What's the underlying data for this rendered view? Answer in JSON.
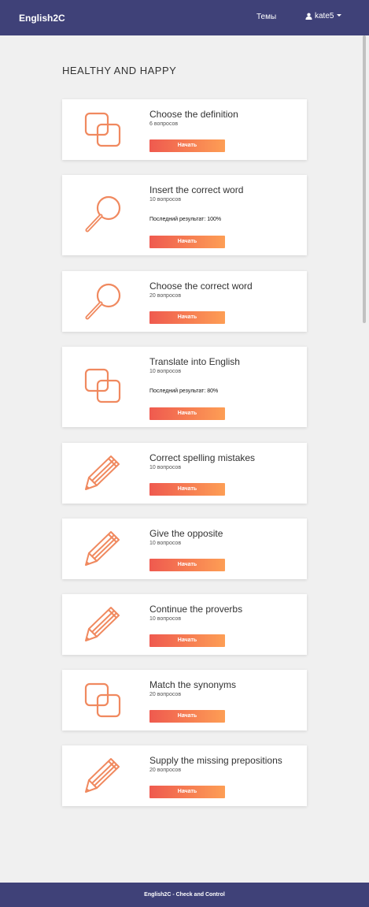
{
  "navbar": {
    "brand": "English2C",
    "topics_label": "Темы",
    "user_name": "kate5",
    "user_icon": "user-icon"
  },
  "page": {
    "title": "HEALTHY AND HAPPY"
  },
  "cards": [
    {
      "title": "Choose the definition",
      "count": "6 вопросов",
      "result": "",
      "button": "Начать",
      "icon": "squares-icon"
    },
    {
      "title": "Insert the correct word",
      "count": "10 вопросов",
      "result": "Последний результат: 100%",
      "button": "Начать",
      "icon": "magnifier-icon"
    },
    {
      "title": "Choose the correct word",
      "count": "20 вопросов",
      "result": "",
      "button": "Начать",
      "icon": "magnifier-icon"
    },
    {
      "title": "Translate into English",
      "count": "10 вопросов",
      "result": "Последний результат: 80%",
      "button": "Начать",
      "icon": "squares-icon"
    },
    {
      "title": "Correct spelling mistakes",
      "count": "10 вопросов",
      "result": "",
      "button": "Начать",
      "icon": "pencil-icon"
    },
    {
      "title": "Give the opposite",
      "count": "10 вопросов",
      "result": "",
      "button": "Начать",
      "icon": "pencil-icon"
    },
    {
      "title": "Continue the proverbs",
      "count": "10 вопросов",
      "result": "",
      "button": "Начать",
      "icon": "pencil-icon"
    },
    {
      "title": "Match the synonyms",
      "count": "20 вопросов",
      "result": "",
      "button": "Начать",
      "icon": "squares-icon"
    },
    {
      "title": "Supply the missing prepositions",
      "count": "20 вопросов",
      "result": "",
      "button": "Начать",
      "icon": "pencil-icon"
    }
  ],
  "footer": {
    "text": "English2C - Check and Control"
  },
  "colors": {
    "navbar": "#3f4178",
    "accent_icon": "#f0895f",
    "button_gradient_start": "#ef5a4f",
    "button_gradient_end": "#fd9e55",
    "background": "#f0f0f0"
  }
}
